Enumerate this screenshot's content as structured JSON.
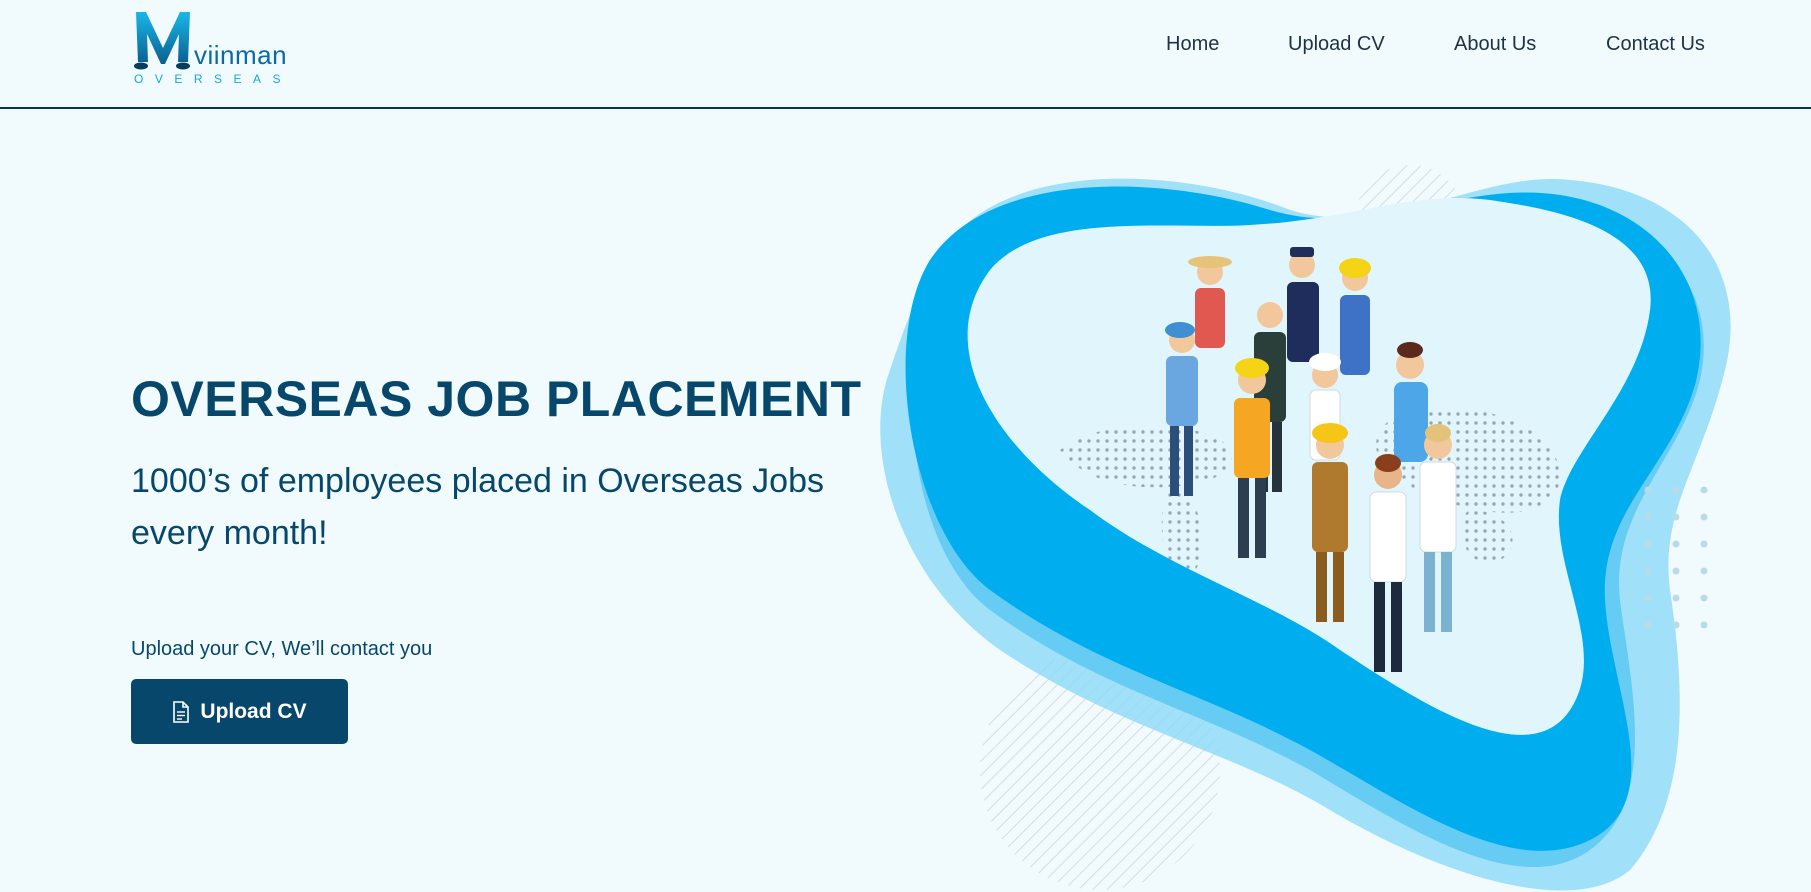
{
  "brand": {
    "name": "viinman",
    "sub": "OVERSEAS",
    "colors": {
      "primary": "#07476b",
      "accent": "#12a8e0",
      "blob": "#00aeef",
      "blob_light": "#7fd4f6"
    }
  },
  "nav": {
    "items": [
      {
        "label": "Home"
      },
      {
        "label": "Upload CV"
      },
      {
        "label": "About Us"
      },
      {
        "label": "Contact Us"
      }
    ]
  },
  "hero": {
    "title": "OVERSEAS JOB PLACEMENT",
    "subtitle": "1000’s of employees placed in Overseas Jobs every month!",
    "cta_text": "Upload your CV, We’ll contact you",
    "cta_button": "Upload CV",
    "cta_icon": "document-icon",
    "illustration": "workers-on-world-map-illustration"
  }
}
